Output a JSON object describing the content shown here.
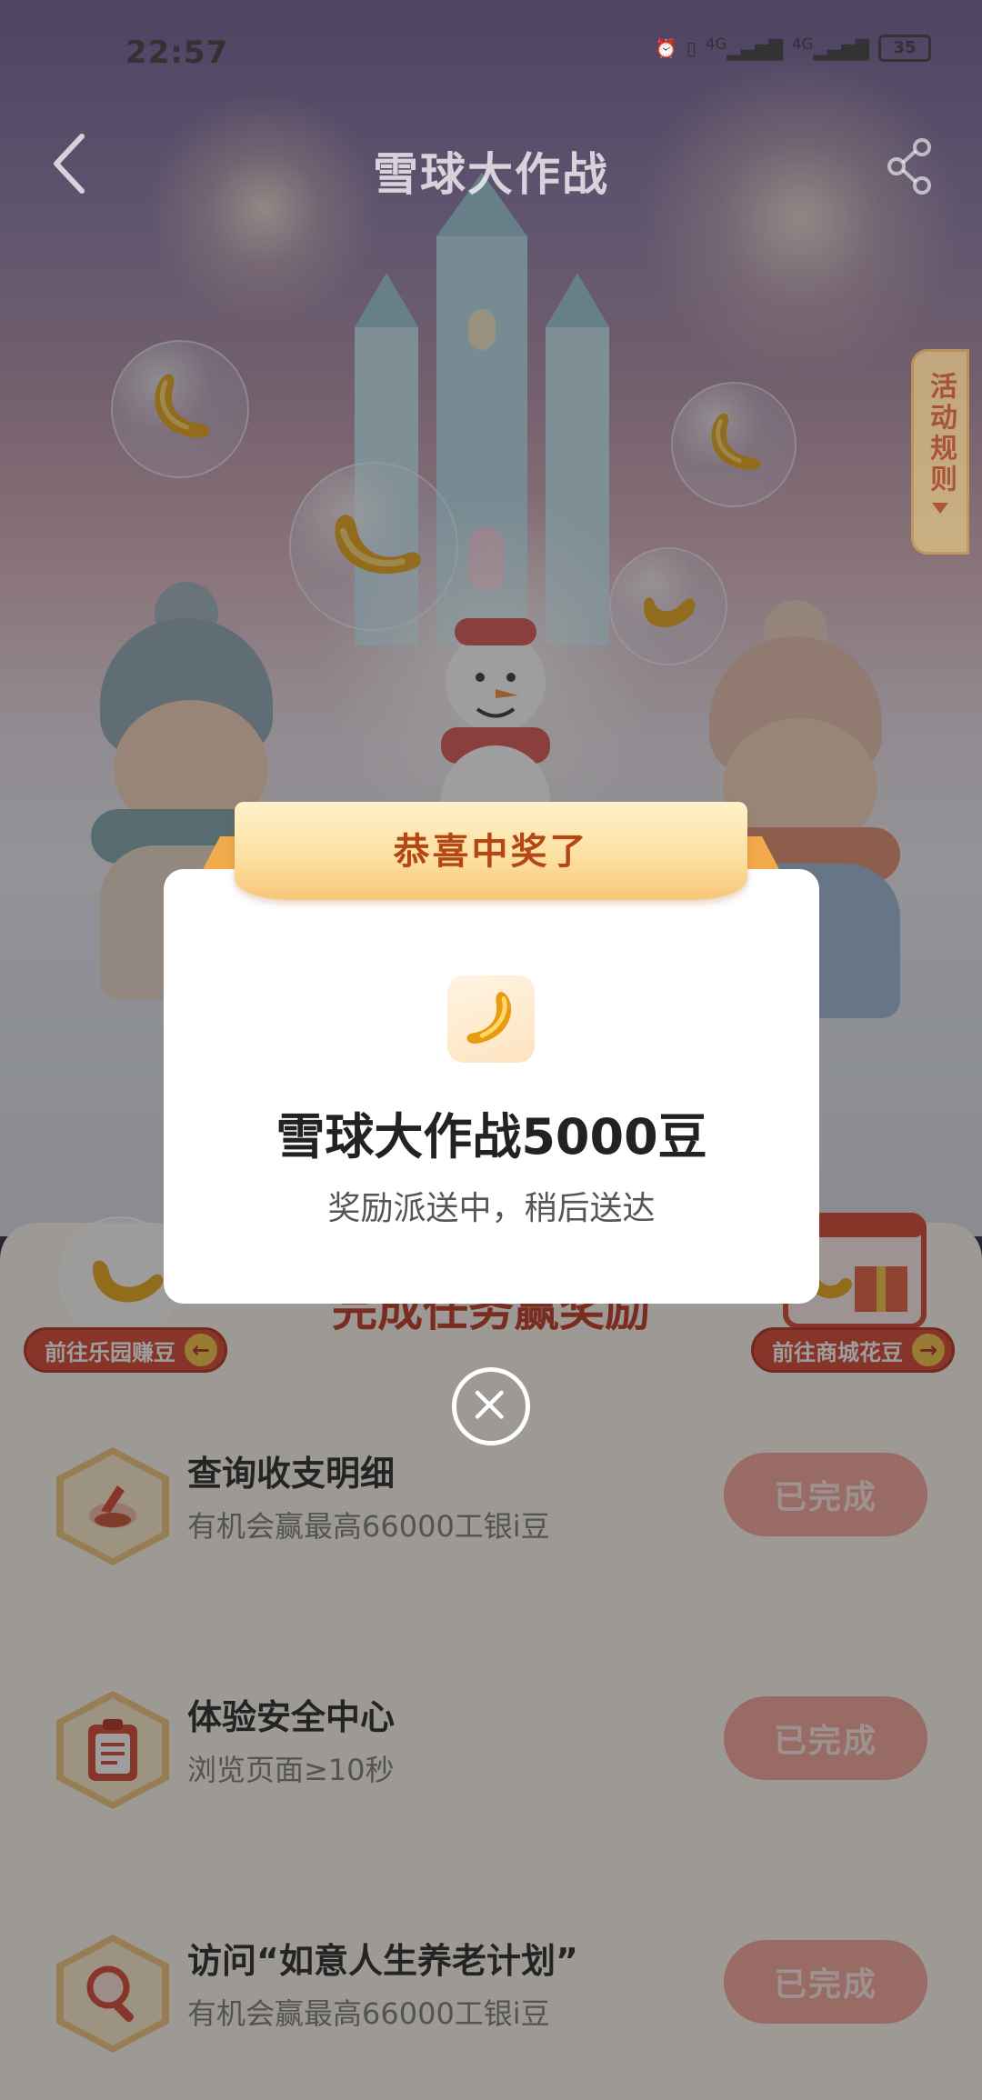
{
  "status_bar": {
    "time": "22:57",
    "network_1": "4G",
    "network_2": "4G",
    "battery": "35"
  },
  "nav": {
    "title": "雪球大作战",
    "back_icon": "chevron-left-icon",
    "share_icon": "share-icon"
  },
  "rules_tab": {
    "label": "活动规则"
  },
  "panel": {
    "title": "完成任务赢奖励",
    "left_button": "前往乐园赚豆",
    "right_button": "前往商城花豆",
    "tasks": [
      {
        "title": "查询收支明细",
        "desc": "有机会赢最高66000工银i豆",
        "button": "已完成",
        "icon": "piggy-bank-icon"
      },
      {
        "title": "体验安全中心",
        "desc": "浏览页面≥10秒",
        "button": "已完成",
        "icon": "clipboard-icon"
      },
      {
        "title": "访问“如意人生养老计划”",
        "desc": "有机会赢最高66000工银i豆",
        "button": "已完成",
        "icon": "magnifier-icon"
      }
    ]
  },
  "modal": {
    "ribbon": "恭喜中奖了",
    "prize_title": "雪球大作战5000豆",
    "prize_subtitle": "奖励派送中，稍后送达",
    "icon": "bean-icon"
  },
  "colors": {
    "accent": "#c0311b",
    "done_button": "#f5a295",
    "ribbon": "#fde0a3"
  }
}
